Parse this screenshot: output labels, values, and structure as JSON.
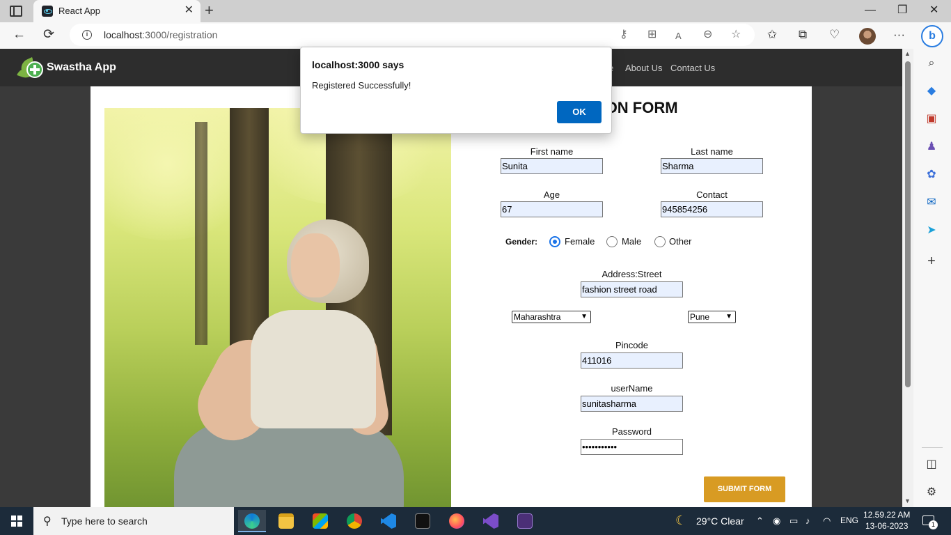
{
  "browser": {
    "tab_title": "React App",
    "tab_close": "✕",
    "new_tab": "+",
    "minimize": "—",
    "restore": "❐",
    "close": "✕",
    "back": "←",
    "refresh": "⟳",
    "url_host": "localhost",
    "url_path": ":3000/registration",
    "info": "i",
    "more": "···",
    "bing": "b"
  },
  "app": {
    "brand": "Swastha App",
    "nav": [
      "e",
      "About Us",
      "Contact Us"
    ]
  },
  "form": {
    "title": "RATION FORM",
    "first_name_label": "First name",
    "first_name_value": "Sunita",
    "last_name_label": "Last name",
    "last_name_value": "Sharma",
    "age_label": "Age",
    "age_value": "67",
    "contact_label": "Contact",
    "contact_value": "945854256",
    "gender_label": "Gender:",
    "gender_options": [
      "Female",
      "Male",
      "Other"
    ],
    "gender_selected": "Female",
    "street_label": "Address:Street",
    "street_value": "fashion street road",
    "state_value": "Maharashtra",
    "city_value": "Pune",
    "pincode_label": "Pincode",
    "pincode_value": "411016",
    "username_label": "userName",
    "username_value": "sunitasharma",
    "password_label": "Password",
    "password_value": "•••••••••••",
    "submit_label": "SUBMIT FORM"
  },
  "dialog": {
    "title": "localhost:3000 says",
    "message": "Registered Successfully!",
    "ok_label": "OK"
  },
  "taskbar": {
    "search_placeholder": "Type here to search",
    "weather": "29°C  Clear",
    "language": "ENG",
    "time": "12.59.22 AM",
    "date": "13-06-2023",
    "notification_count": "1"
  },
  "colors": {
    "submit": "#d89b23",
    "dialog_ok": "#0067c0",
    "header": "#2d2d2d",
    "taskbar": "#1c2b3a"
  }
}
